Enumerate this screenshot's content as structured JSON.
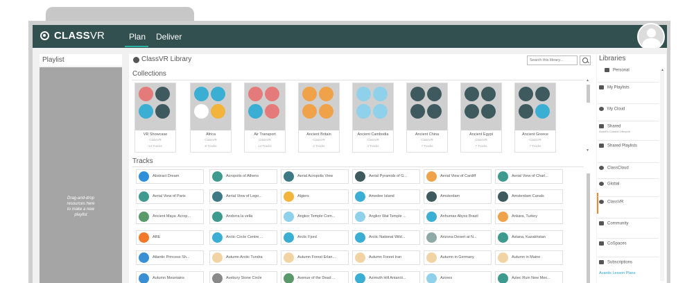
{
  "brand": {
    "part1": "CLASS",
    "part2": "VR"
  },
  "nav": [
    {
      "label": "Plan",
      "active": true
    },
    {
      "label": "Deliver",
      "active": false
    }
  ],
  "playlist": {
    "title": "Playlist",
    "hint": "Drag-and-drop\nresources here\nto make a new\nplaylist"
  },
  "library": {
    "title": "ClassVR Library",
    "search_placeholder": "Search this library...",
    "collections_label": "Collections",
    "tracks_label": "Tracks",
    "collections": [
      {
        "name": "VR Showcase",
        "owner": "ClassVR",
        "count": "14 Tracks",
        "colors": [
          "#e57a7a",
          "#3e5a5e",
          "#3aaed3",
          "#3e5a5e"
        ],
        "icons": [
          "rocket",
          "pyramid",
          "mountain",
          "pyramid"
        ]
      },
      {
        "name": "Africa",
        "owner": "ClassVR",
        "count": "8 Tracks",
        "colors": [
          "#3aaed3",
          "#3aaed3",
          "#ffffff",
          "#f2b43a"
        ],
        "icons": [
          "mountain",
          "building",
          "palm",
          "hut"
        ]
      },
      {
        "name": "Air Transport",
        "owner": "ClassVR",
        "count": "14 Tracks",
        "colors": [
          "#e57a7a",
          "#e57a7a",
          "#3aaed3",
          "#e57a7a"
        ],
        "icons": [
          "plane",
          "plane",
          "plane",
          "plane"
        ]
      },
      {
        "name": "Ancient Britain",
        "owner": "ClassVR",
        "count": "2 Tracks",
        "colors": [
          "#f0a24a",
          "#f0a24a",
          "#f0a24a",
          "#f0a24a"
        ],
        "icons": [
          "stones",
          "stones",
          "stones",
          "stones"
        ]
      },
      {
        "name": "Ancient Cambodia",
        "owner": "ClassVR",
        "count": "4 Tracks",
        "colors": [
          "#8fd0ea",
          "#8fd0ea",
          "#8fd0ea",
          "#8fd0ea"
        ],
        "icons": [
          "temple",
          "temple",
          "temple",
          "temple"
        ]
      },
      {
        "name": "Ancient China",
        "owner": "ClassVR",
        "count": "7 Tracks",
        "colors": [
          "#3e5a5e",
          "#3e5a5e",
          "#3e5a5e",
          "#3e5a5e"
        ],
        "icons": [
          "pagoda",
          "pagoda",
          "pagoda",
          "pagoda"
        ]
      },
      {
        "name": "Ancient Egypt",
        "owner": "ClassVR",
        "count": "7 Tracks",
        "colors": [
          "#3e5a5e",
          "#3e5a5e",
          "#3e5a5e",
          "#3e5a5e"
        ],
        "icons": [
          "pyramid",
          "pyramid",
          "pyramid",
          "pyramid"
        ]
      },
      {
        "name": "Ancient Greece",
        "owner": "ClassVR",
        "count": "7 Tracks",
        "colors": [
          "#3e5a5e",
          "#3e5a5e",
          "#3e5a5e",
          "#3aaed3"
        ],
        "icons": [
          "columns",
          "columns",
          "columns",
          "mountain"
        ]
      }
    ],
    "tracks": [
      [
        "Abstract Dream",
        "Acropolis of Athens",
        "Aerial Acropolis View",
        "Aerial Pyramids of G...",
        "Aerial View of Cardiff",
        "Aerial View of Charl..."
      ],
      [
        "Aerial View of Paris",
        "Aerial View of Lego...",
        "Algiers",
        "Amedee Island",
        "Amsterdam",
        "Amsterdam Canals"
      ],
      [
        "Ancient Maya: Acrop...",
        "Andorra la vella",
        "Angkor Temple Com...",
        "Angkor Wat Temple ...",
        "Anhumas Abyss Brazil",
        "Ankara, Turkey"
      ],
      [
        "ARE",
        "Arctic Circle Centre ...",
        "Arctic Fjord",
        "Arctic National Wild...",
        "Arizona Desert at N...",
        "Astana, Kazakhstan"
      ],
      [
        "Atlantic Princess Sh...",
        "Autumn Arctic Tundra",
        "Autumn Forest Erlan...",
        "Autumn Forest Iran",
        "Autumn in Germany",
        "Autumn in Maine"
      ],
      [
        "Autumn Mountains",
        "Avebury Stone Circle",
        "Avenue of the Dead ...",
        "Azimuth Hill Antarcti...",
        "Azores",
        "Aztec Ruin New Mex..."
      ]
    ],
    "track_colors": [
      [
        "#2d8fd9",
        "#3e9a8e",
        "#3e7a86",
        "#3e5a5e",
        "#f0a24a",
        "#3e9a8e"
      ],
      [
        "#3e9a8e",
        "#3e7a86",
        "#f2b43a",
        "#3aaed3",
        "#3e5a5e",
        "#3e5a5e"
      ],
      [
        "#5a9a6a",
        "#3e9a8e",
        "#8fd0ea",
        "#8fd0ea",
        "#3aaed3",
        "#f0a24a"
      ],
      [
        "#f07a2a",
        "#3aaed3",
        "#3aaed3",
        "#3aaed3",
        "#8fa9a9",
        "#3e9a8e"
      ],
      [
        "#3a8ed3",
        "#f2d4a4",
        "#f2d4a4",
        "#f2d4a4",
        "#f2d4a4",
        "#f2d4a4"
      ],
      [
        "#3a8ed3",
        "#8a8a8a",
        "#5a9a6a",
        "#3aaed3",
        "#8fd0ea",
        "#3e9a8e"
      ]
    ]
  },
  "libraries": {
    "title": "Libraries",
    "items": [
      {
        "label": "Personal",
        "icon": "person-icon"
      },
      {
        "label": "My Playlists",
        "icon": "playlist-icon"
      },
      {
        "label": "My Cloud",
        "icon": "cloud-icon"
      },
      {
        "label": "Shared",
        "icon": "shared-icon",
        "sub": "Avanti's Coastal Lifecycle"
      },
      {
        "label": "Shared Playlists",
        "icon": "playlist-icon"
      },
      {
        "label": "ClassCloud",
        "icon": "cloud-icon"
      },
      {
        "label": "Global",
        "icon": "globe-icon"
      },
      {
        "label": "ClassVR",
        "icon": "classvr-icon"
      },
      {
        "label": "Community",
        "icon": "community-icon"
      },
      {
        "label": "CoSpaces",
        "icon": "cospaces-icon"
      },
      {
        "label": "Subscriptions",
        "icon": "subscriptions-icon"
      }
    ],
    "link": "Avantis Lesson Plans"
  },
  "colors": {
    "topbar": "#32504f",
    "accent": "#2bb3a3",
    "active": "#e88a2b"
  }
}
